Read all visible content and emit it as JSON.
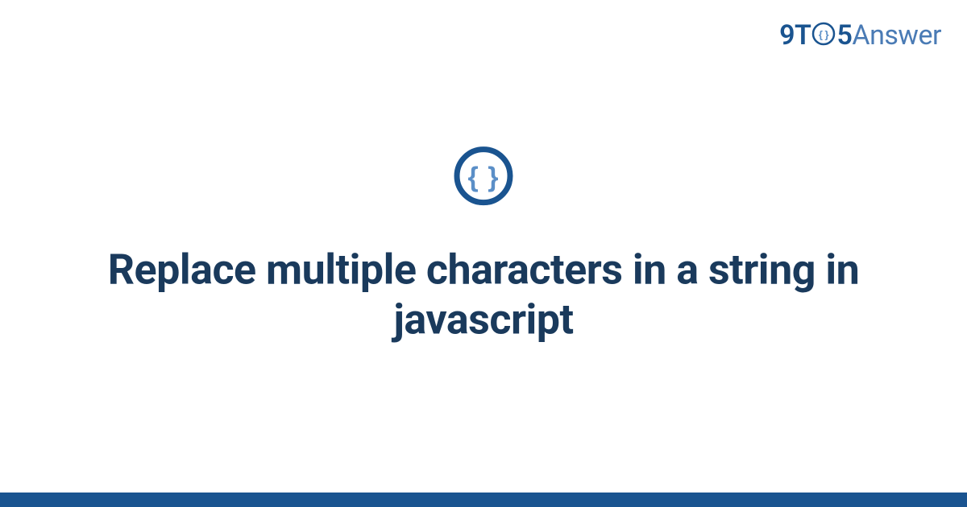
{
  "logo": {
    "part1": "9",
    "part2": "T",
    "part3": "5",
    "part4": "Answer"
  },
  "main": {
    "title": "Replace multiple characters in a string in javascript"
  },
  "colors": {
    "brand_dark": "#1a5490",
    "brand_light": "#4a7bb5",
    "title_color": "#1a3a5c",
    "icon_inner": "#5b8fc7"
  }
}
